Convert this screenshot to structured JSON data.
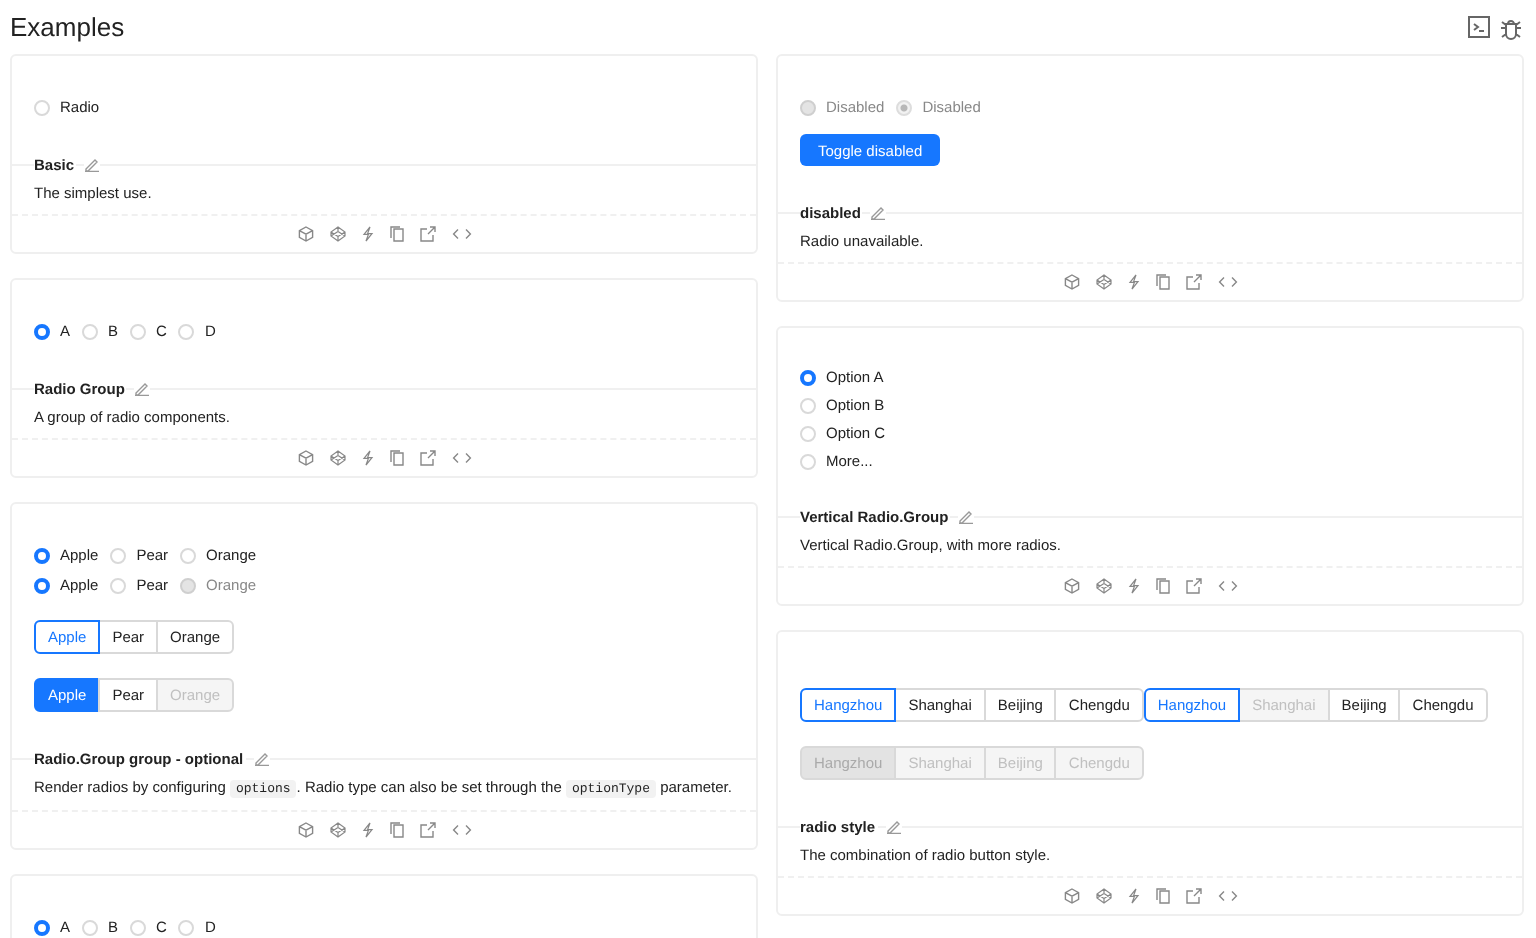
{
  "page": {
    "title": "Examples"
  },
  "columns": [
    [
      {
        "title": "Basic",
        "description": [
          {
            "kind": "text",
            "text": "The simplest use."
          }
        ],
        "demo": [
          {
            "kind": "radios",
            "items": [
              {
                "label": "Radio",
                "selected": false,
                "disabled": false
              }
            ]
          }
        ]
      },
      {
        "title": "Radio Group",
        "description": [
          {
            "kind": "text",
            "text": "A group of radio components."
          }
        ],
        "demo": [
          {
            "kind": "radios",
            "items": [
              {
                "label": "A",
                "selected": true,
                "disabled": false
              },
              {
                "label": "B",
                "selected": false,
                "disabled": false
              },
              {
                "label": "C",
                "selected": false,
                "disabled": false
              },
              {
                "label": "D",
                "selected": false,
                "disabled": false
              }
            ]
          }
        ]
      },
      {
        "title": "Radio.Group group - optional",
        "description": [
          {
            "kind": "text",
            "text": "Render radios by configuring "
          },
          {
            "kind": "code",
            "text": "options"
          },
          {
            "kind": "text",
            "text": ". Radio type can also be set through the "
          },
          {
            "kind": "code",
            "text": "optionType"
          },
          {
            "kind": "text",
            "text": " parameter."
          }
        ],
        "demo": [
          {
            "kind": "radios",
            "items": [
              {
                "label": "Apple",
                "selected": true,
                "disabled": false
              },
              {
                "label": "Pear",
                "selected": false,
                "disabled": false
              },
              {
                "label": "Orange",
                "selected": false,
                "disabled": false
              }
            ]
          },
          {
            "kind": "radios",
            "items": [
              {
                "label": "Apple",
                "selected": true,
                "disabled": false
              },
              {
                "label": "Pear",
                "selected": false,
                "disabled": false
              },
              {
                "label": "Orange",
                "selected": false,
                "disabled": true
              }
            ]
          },
          {
            "kind": "button-groups",
            "groups": [
              {
                "kind": "outline",
                "items": [
                  {
                    "label": "Apple",
                    "selected": true,
                    "disabled": false
                  },
                  {
                    "label": "Pear",
                    "selected": false,
                    "disabled": false
                  },
                  {
                    "label": "Orange",
                    "selected": false,
                    "disabled": false
                  }
                ]
              }
            ]
          },
          {
            "kind": "button-groups",
            "groups": [
              {
                "kind": "solid",
                "items": [
                  {
                    "label": "Apple",
                    "selected": true,
                    "disabled": false
                  },
                  {
                    "label": "Pear",
                    "selected": false,
                    "disabled": false
                  },
                  {
                    "label": "Orange",
                    "selected": false,
                    "disabled": true
                  }
                ]
              }
            ]
          }
        ]
      },
      {
        "demo": [
          {
            "kind": "radios",
            "items": [
              {
                "label": "A",
                "selected": true,
                "disabled": false
              },
              {
                "label": "B",
                "selected": false,
                "disabled": false
              },
              {
                "label": "C",
                "selected": false,
                "disabled": false
              },
              {
                "label": "D",
                "selected": false,
                "disabled": false
              }
            ]
          }
        ]
      }
    ],
    [
      {
        "title": "disabled",
        "description": [
          {
            "kind": "text",
            "text": "Radio unavailable."
          }
        ],
        "demo": [
          {
            "kind": "radios",
            "items": [
              {
                "label": "Disabled",
                "selected": false,
                "disabled": true
              },
              {
                "label": "Disabled",
                "selected": true,
                "disabled": true
              }
            ]
          },
          {
            "kind": "button",
            "label": "Toggle disabled"
          }
        ]
      },
      {
        "title": "Vertical Radio.Group",
        "description": [
          {
            "kind": "text",
            "text": "Vertical Radio.Group, with more radios."
          }
        ],
        "demo": [
          {
            "kind": "vertical",
            "items": [
              {
                "label": "Option A",
                "selected": true,
                "disabled": false
              },
              {
                "label": "Option B",
                "selected": false,
                "disabled": false
              },
              {
                "label": "Option C",
                "selected": false,
                "disabled": false
              },
              {
                "label": "More...",
                "selected": false,
                "disabled": false
              }
            ]
          }
        ]
      },
      {
        "title": "radio style",
        "description": [
          {
            "kind": "text",
            "text": "The combination of radio button style."
          }
        ],
        "demo": [
          {
            "kind": "button-groups",
            "groups": [
              {
                "kind": "outline",
                "items": [
                  {
                    "label": "Hangzhou",
                    "selected": true,
                    "disabled": false
                  },
                  {
                    "label": "Shanghai",
                    "selected": false,
                    "disabled": false
                  },
                  {
                    "label": "Beijing",
                    "selected": false,
                    "disabled": false
                  },
                  {
                    "label": "Chengdu",
                    "selected": false,
                    "disabled": false
                  }
                ]
              },
              {
                "kind": "outline",
                "items": [
                  {
                    "label": "Hangzhou",
                    "selected": true,
                    "disabled": false
                  },
                  {
                    "label": "Shanghai",
                    "selected": false,
                    "disabled": true
                  },
                  {
                    "label": "Beijing",
                    "selected": false,
                    "disabled": false
                  },
                  {
                    "label": "Chengdu",
                    "selected": false,
                    "disabled": false
                  }
                ]
              }
            ]
          },
          {
            "kind": "button-groups",
            "groups": [
              {
                "kind": "outline",
                "items": [
                  {
                    "label": "Hangzhou",
                    "selected": true,
                    "disabled": true
                  },
                  {
                    "label": "Shanghai",
                    "selected": false,
                    "disabled": true
                  },
                  {
                    "label": "Beijing",
                    "selected": false,
                    "disabled": true
                  },
                  {
                    "label": "Chengdu",
                    "selected": false,
                    "disabled": true
                  }
                ]
              }
            ]
          }
        ]
      }
    ]
  ]
}
